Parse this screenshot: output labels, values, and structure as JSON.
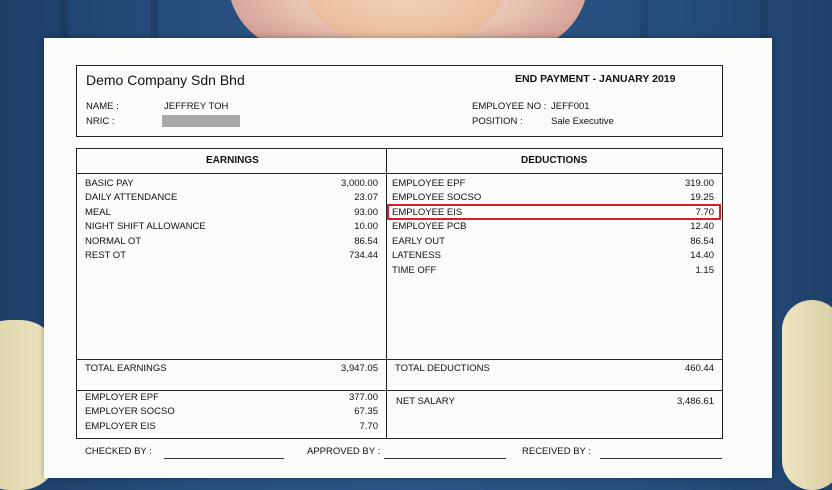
{
  "header": {
    "company": "Demo Company Sdn Bhd",
    "title": "END PAYMENT  -  JANUARY 2019",
    "name_label": "NAME :",
    "name_value": "JEFFREY TOH",
    "nric_label": "NRIC :",
    "employee_no_label": "EMPLOYEE NO :",
    "employee_no_value": "JEFF001",
    "position_label": "POSITION :",
    "position_value": "Sale Executive"
  },
  "earnings": {
    "heading": "EARNINGS",
    "items": [
      {
        "label": "BASIC PAY",
        "amount": "3,000.00"
      },
      {
        "label": "DAILY ATTENDANCE",
        "amount": "23.07"
      },
      {
        "label": "MEAL",
        "amount": "93.00"
      },
      {
        "label": "NIGHT SHIFT ALLOWANCE",
        "amount": "10.00"
      },
      {
        "label": "NORMAL OT",
        "amount": "86.54"
      },
      {
        "label": "REST OT",
        "amount": "734.44"
      }
    ],
    "total_label": "TOTAL EARNINGS",
    "total_value": "3,947.05"
  },
  "deductions": {
    "heading": "DEDUCTIONS",
    "items": [
      {
        "label": "EMPLOYEE EPF",
        "amount": "319.00"
      },
      {
        "label": "EMPLOYEE SOCSO",
        "amount": "19.25"
      },
      {
        "label": "EMPLOYEE EIS",
        "amount": "7.70"
      },
      {
        "label": "EMPLOYEE PCB",
        "amount": "12.40"
      },
      {
        "label": "EARLY OUT",
        "amount": "86.54"
      },
      {
        "label": "LATENESS",
        "amount": "14.40"
      },
      {
        "label": "TIME OFF",
        "amount": "1.15"
      }
    ],
    "total_label": "TOTAL DEDUCTIONS",
    "total_value": "460.44"
  },
  "employer": {
    "items": [
      {
        "label": "EMPLOYER EPF",
        "amount": "377.00"
      },
      {
        "label": "EMPLOYER SOCSO",
        "amount": "67.35"
      },
      {
        "label": "EMPLOYER EIS",
        "amount": "7.70"
      }
    ]
  },
  "net": {
    "label": "NET SALARY",
    "value": "3,486.61"
  },
  "signatures": {
    "checked": "CHECKED BY :",
    "approved": "APPROVED BY :",
    "received": "RECEIVED BY :"
  },
  "colors": {
    "highlight": "#d21f2a",
    "background": "#27507f"
  }
}
